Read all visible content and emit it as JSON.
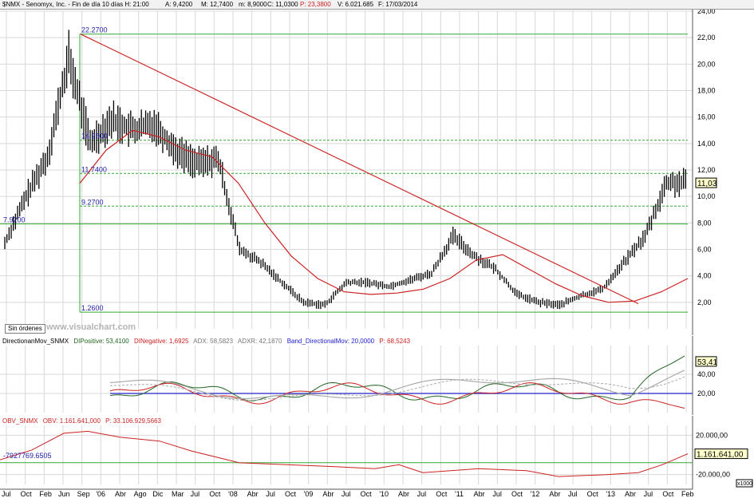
{
  "header": {
    "symbol": "$NMX - Senomyx, Inc. - Fin de día 10 días H: 21:00",
    "open": "A: 9,4200",
    "high": "M: 12,7400",
    "low": "m: 8,9000",
    "close": "C: 11,0300",
    "p": "P: 23,3800",
    "volume": "V: 6.021.685",
    "date": "F: 17/03/2014"
  },
  "watermark": "www.visualchart.com",
  "sin_ordenes": "Sin órdenes",
  "colors": {
    "price": "#000000",
    "ma": "#cc2222",
    "trendline": "#cc2222",
    "hline": "#33aa33",
    "diplus": "#226622",
    "diminus": "#cc2222",
    "adx": "#aaaaaa",
    "adxr": "#aaaaaa",
    "band": "#2222cc",
    "obv": "#cc2222",
    "grid": "#d8d8d8"
  },
  "chart_data": [
    {
      "type": "line",
      "name": "price",
      "ylim": [
        0,
        24
      ],
      "y_ticks": [
        "24,00",
        "22,00",
        "20,00",
        "18,00",
        "16,00",
        "14,00",
        "12,00",
        "10,00",
        "8,00",
        "6,00",
        "4,00",
        "2,00"
      ],
      "last_value_label": "11,03",
      "annotations": [
        "22.2700",
        "14.2500",
        "11.7400",
        "9.2700",
        "7.9200",
        "1.2600"
      ],
      "x": [
        "Jul",
        "Oct",
        "Feb",
        "Jun",
        "Sep",
        "'06",
        "Abr",
        "Ago",
        "Dic",
        "Mar",
        "Jul",
        "Oct",
        "'08",
        "Abr",
        "Jul",
        "Oct",
        "'09",
        "Abr",
        "Jul",
        "Oct",
        "'10",
        "Abr",
        "Jul",
        "Oct",
        "'11",
        "Abr",
        "Jul",
        "Oct",
        "'12",
        "Abr",
        "Jul",
        "Oct",
        "'13",
        "Abr",
        "Jul",
        "Oct",
        "Feb"
      ],
      "series": [
        {
          "values": [
            6.5,
            10.0,
            13.0,
            20.5,
            14.0,
            15.8,
            15.0,
            15.5,
            13.5,
            12.5,
            12.8,
            6.0,
            5.0,
            3.5,
            2.0,
            1.8,
            3.5,
            3.5,
            3.2,
            3.7,
            4.2,
            7.0,
            5.5,
            4.5,
            2.6,
            2.0,
            1.8,
            2.5,
            3.0,
            5.0,
            7.0,
            11.0,
            11.03
          ]
        },
        {
          "values": [
            11.0,
            13.5,
            15.0,
            14.5,
            13.5,
            13.0,
            11.0,
            8.0,
            5.5,
            3.8,
            2.8,
            2.6,
            2.7,
            3.0,
            3.8,
            5.2,
            5.6,
            4.5,
            3.4,
            2.5,
            2.0,
            2.1,
            2.8,
            3.8
          ]
        }
      ]
    },
    {
      "type": "line",
      "name": "directional_movement",
      "values_shown": {
        "di_positive": "53,4100",
        "di_negative": "1,6925",
        "adx": "58,5823",
        "adxr": "42,1870",
        "band": "20,0000",
        "p": "68,5243"
      },
      "y_ticks": [
        "40,00",
        "20,00"
      ],
      "last_value_label": "53,41"
    },
    {
      "type": "line",
      "name": "obv",
      "values_shown": {
        "obv": "1.161.641,000",
        "p": "33.106.929,5663"
      },
      "y_ticks": [
        "20.000,00",
        "-20.000,00"
      ],
      "left_label": "-7927769.6505",
      "last_value_label": "1.161.641,00",
      "scale_label": "x1000"
    }
  ],
  "x_axis": [
    "Jul",
    "Oct",
    "Feb",
    "Jun",
    "Sep",
    "'06",
    "Abr",
    "Ago",
    "Dic",
    "Mar",
    "Jul",
    "Oct",
    "'08",
    "Abr",
    "Jul",
    "Oct",
    "'09",
    "Abr",
    "Jul",
    "Oct",
    "'10",
    "Abr",
    "Jul",
    "Oct",
    "'11",
    "Abr",
    "Jul",
    "Oct",
    "'12",
    "Abr",
    "Jul",
    "Oct",
    "'13",
    "Abr",
    "Jul",
    "Oct",
    "Feb"
  ],
  "dm_title": {
    "name": "DirectionanMov_SNMX",
    "dip_label": "DIPositive: 53,4100",
    "din_label": "DINegative: 1,6925",
    "adx_label": "ADX: 58,5823",
    "adxr_label": "ADXR: 42,1870",
    "band_label": "Band_DirectionalMov: 20,0000",
    "p_label": "P: 68,5243"
  },
  "obv_title": {
    "name": "OBV_SNMX",
    "obv_label": "OBV: 1.161.641,000",
    "p_label": "P: 33.106.929,5663"
  }
}
